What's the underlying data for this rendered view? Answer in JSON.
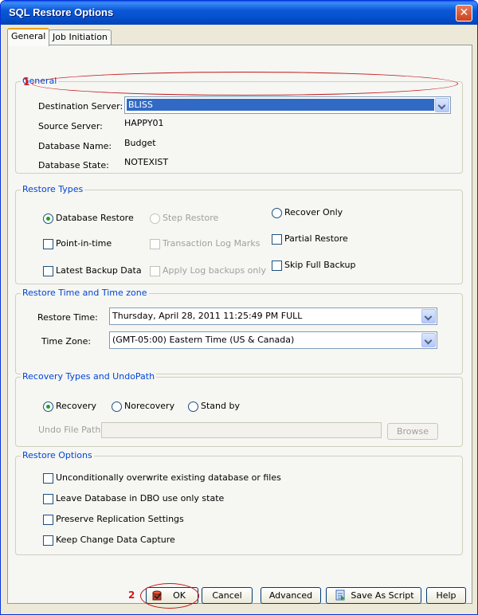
{
  "window": {
    "title": "SQL Restore Options",
    "close_glyph": "✕"
  },
  "tabs": [
    "General",
    "Job Initiation"
  ],
  "general": {
    "legend": "General",
    "destination_server_label": "Destination Server:",
    "destination_server_value": "BLISS",
    "source_server_label": "Source Server:",
    "source_server_value": "HAPPY01",
    "database_name_label": "Database Name:",
    "database_name_value": "Budget",
    "database_state_label": "Database State:",
    "database_state_value": "NOTEXIST"
  },
  "restore_types": {
    "legend": "Restore Types",
    "database_restore": "Database Restore",
    "step_restore": "Step Restore",
    "recover_only": "Recover Only",
    "point_in_time": "Point-in-time",
    "transaction_log_marks": "Transaction Log Marks",
    "partial_restore": "Partial Restore",
    "latest_backup_data": "Latest Backup Data",
    "apply_log_backups_only": "Apply Log backups only",
    "skip_full_backup": "Skip Full Backup"
  },
  "restore_time": {
    "legend": "Restore Time and Time zone",
    "restore_time_label": "Restore Time:",
    "restore_time_value": "Thursday, April 28, 2011 11:25:49 PM FULL",
    "time_zone_label": "Time Zone:",
    "time_zone_value": "(GMT-05:00) Eastern Time (US & Canada)"
  },
  "recovery_types": {
    "legend": "Recovery Types and UndoPath",
    "recovery": "Recovery",
    "norecovery": "Norecovery",
    "standby": "Stand by",
    "undo_file_path_label": "Undo File Path:",
    "undo_file_path_value": "",
    "browse": "Browse"
  },
  "restore_options": {
    "legend": "Restore Options",
    "items": [
      "Unconditionally overwrite existing database or files",
      "Leave Database in DBO use only state",
      "Preserve Replication Settings",
      "Keep Change Data Capture"
    ]
  },
  "buttons": {
    "ok": "OK",
    "cancel": "Cancel",
    "advanced": "Advanced",
    "save_as_script": "Save As Script",
    "help": "Help"
  },
  "annotations": {
    "marker_1": "1",
    "marker_2": "2"
  },
  "colors": {
    "title_bar": "#0a58d8",
    "group_legend": "#0046d5",
    "annotation": "#c0181a",
    "selection": "#316ac5"
  }
}
